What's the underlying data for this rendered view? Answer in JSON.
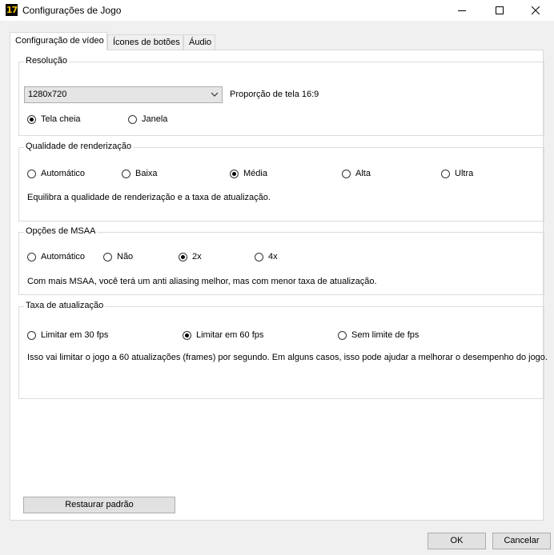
{
  "window": {
    "title": "Configurações de Jogo",
    "icon_text": "17"
  },
  "tabs": [
    {
      "label": "Configuração de vídeo",
      "active": true
    },
    {
      "label": "Ícones de botões",
      "active": false
    },
    {
      "label": "Áudio",
      "active": false
    }
  ],
  "resolution": {
    "legend": "Resolução",
    "selected": "1280x720",
    "aspect_label": "Proporção de tela 16:9",
    "modes": [
      {
        "label": "Tela cheia",
        "checked": true
      },
      {
        "label": "Janela",
        "checked": false
      }
    ]
  },
  "render_quality": {
    "legend": "Qualidade de renderização",
    "options": [
      {
        "label": "Automático",
        "checked": false
      },
      {
        "label": "Baixa",
        "checked": false
      },
      {
        "label": "Média",
        "checked": true
      },
      {
        "label": "Alta",
        "checked": false
      },
      {
        "label": "Ultra",
        "checked": false
      }
    ],
    "description": "Equilibra a qualidade de renderização e a taxa de atualização."
  },
  "msaa": {
    "legend": "Opções de MSAA",
    "options": [
      {
        "label": "Automático",
        "checked": false
      },
      {
        "label": "Não",
        "checked": false
      },
      {
        "label": "2x",
        "checked": true
      },
      {
        "label": "4x",
        "checked": false
      }
    ],
    "description": "Com mais MSAA, você terá um anti aliasing melhor, mas com menor taxa de atualização."
  },
  "framerate": {
    "legend": "Taxa de atualização",
    "options": [
      {
        "label": "Limitar em 30 fps",
        "checked": false
      },
      {
        "label": "Limitar em 60 fps",
        "checked": true
      },
      {
        "label": "Sem limite de fps",
        "checked": false
      }
    ],
    "description": "Isso vai limitar o jogo a 60 atualizações (frames) por segundo. Em alguns casos, isso pode ajudar a melhorar o desempenho do jogo."
  },
  "buttons": {
    "restore": "Restaurar padrão",
    "ok": "OK",
    "cancel": "Cancelar"
  }
}
